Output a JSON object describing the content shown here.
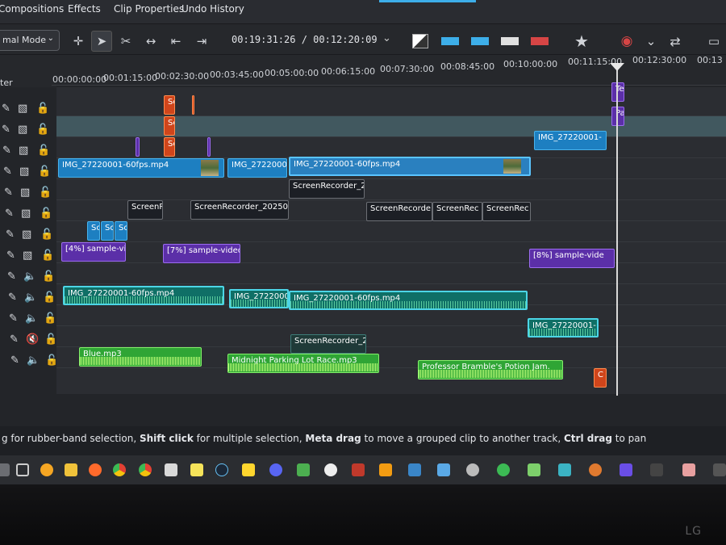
{
  "tabs": [
    {
      "label": "Compositions"
    },
    {
      "label": "Effects"
    },
    {
      "label": "Clip Properties"
    },
    {
      "label": "Undo History"
    }
  ],
  "toolbar": {
    "mode_label": "mal Mode",
    "timecode": "00:19:31:26 / 00:12:20:09"
  },
  "left_header": {
    "label": "ter"
  },
  "ruler": {
    "labels": [
      "00:00:00:00",
      "00:01:15:00",
      "00:02:30:00",
      "00:03:45:00",
      "00:05:00:00",
      "00:06:15:00",
      "00:07:30:00",
      "00:08:45:00",
      "00:10:00:00",
      "00:11:15:00",
      "00:12:30:00",
      "00:13"
    ]
  },
  "clips": {
    "se1": "Se",
    "se2": "Se",
    "se3": "Se",
    "te": "Te",
    "pa": "Pa",
    "img_top": "IMG_27220001-",
    "v1_a": "IMG_27220001-60fps.mp4",
    "v1_b": "IMG_27220001-",
    "v1_c": "IMG_27220001-60fps.mp4",
    "sr_top": "ScreenRecorder_2",
    "sr_1": "ScreenRe",
    "sr_2": "ScreenRecorder_2025050",
    "sr_3": "ScreenRecorde",
    "sr_4": "ScreenRec",
    "sr_5": "ScreenRec",
    "sc1": "Sc",
    "sc2": "Sc",
    "sc3": "Sc",
    "sv1": "[4%] sample-vide",
    "sv2": "[7%] sample-video",
    "sv3": "[8%] sample-vide",
    "a1_a": "IMG_27220001-60fps.mp4",
    "a1_b": "IMG_27220001-",
    "a1_c": "IMG_27220001-60fps.mp4",
    "a2": "IMG_27220001-",
    "a3": "ScreenRecorder_2",
    "m1": "Blue.mp3",
    "m2": "Midnight Parking Lot Race.mp3",
    "m3": "Professor Bramble's Potion Jam.",
    "c": "C"
  },
  "status": {
    "pre": "g for rubber-band selection, ",
    "b1": "Shift click",
    "t1": " for multiple selection, ",
    "b2": "Meta drag",
    "t2": " to move a grouped clip to another track, ",
    "b3": "Ctrl drag",
    "t3": " to pan"
  },
  "monitor": {
    "brand": "LG"
  }
}
